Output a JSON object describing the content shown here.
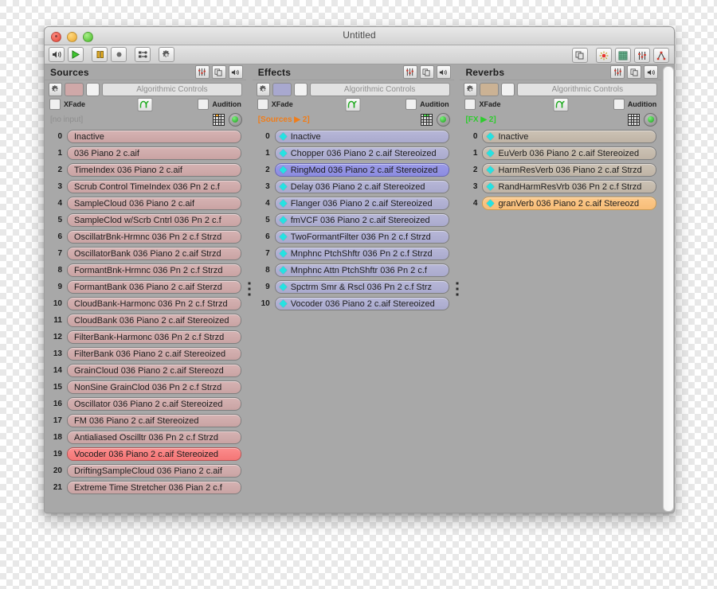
{
  "window": {
    "title": "Untitled",
    "traffic_lights": [
      "close",
      "minimize",
      "zoom"
    ]
  },
  "toolbar": {
    "left_buttons": [
      {
        "name": "speaker-icon",
        "label": "Speaker"
      },
      {
        "name": "play-icon",
        "label": "Play"
      },
      {
        "name": "pause-icon",
        "label": "Pause"
      },
      {
        "name": "record-icon",
        "label": "Record"
      },
      {
        "name": "mixer-icon",
        "label": "Mixer"
      },
      {
        "name": "gear-icon",
        "label": "Settings"
      }
    ],
    "right_buttons": [
      {
        "name": "copy-icon",
        "label": "Copy"
      },
      {
        "name": "sun-icon",
        "label": "Brightness"
      },
      {
        "name": "grid-icon",
        "label": "Grid"
      },
      {
        "name": "faders-icon",
        "label": "Faders"
      },
      {
        "name": "routing-icon",
        "label": "Routing"
      }
    ]
  },
  "panels": [
    {
      "id": "sources",
      "title": "Sources",
      "accent": "#cfa8a8",
      "header_buttons": [
        "faders-icon",
        "copy-icon",
        "speaker-icon"
      ],
      "algorithmic_controls_label": "Algorithmic Controls",
      "xfade_label": "XFade",
      "audition_label": "Audition",
      "input_label": "[no input]",
      "input_label_style": "gray",
      "matrix_led_color": "#f6a21e",
      "items": [
        {
          "index": "0",
          "label": "Inactive",
          "selected": false
        },
        {
          "index": "1",
          "label": " 036 Piano 2 c.aif",
          "selected": false
        },
        {
          "index": "2",
          "label": "TimeIndex 036 Piano 2 c.aif",
          "selected": false
        },
        {
          "index": "3",
          "label": "Scrub Control TimeIndex 036 Pn 2 c.f",
          "selected": false
        },
        {
          "index": "4",
          "label": "SampleCloud 036 Piano 2 c.aif",
          "selected": false
        },
        {
          "index": "5",
          "label": "SampleClod w/Scrb Cntrl 036 Pn 2 c.f",
          "selected": false
        },
        {
          "index": "6",
          "label": "OscillatrBnk-Hrmnc 036 Pn 2 c.f Strzd",
          "selected": false
        },
        {
          "index": "7",
          "label": "OscillatorBank 036 Piano 2 c.aif Strzd",
          "selected": false
        },
        {
          "index": "8",
          "label": "FormantBnk-Hrmnc 036 Pn 2 c.f Strzd",
          "selected": false
        },
        {
          "index": "9",
          "label": "FormantBank 036 Piano 2 c.aif Sterzd",
          "selected": false
        },
        {
          "index": "10",
          "label": "CloudBank-Harmonc 036 Pn 2 c.f Strzd",
          "selected": false
        },
        {
          "index": "11",
          "label": "CloudBank 036 Piano 2 c.aif Stereoized",
          "selected": false
        },
        {
          "index": "12",
          "label": "FilterBank-Harmonc 036 Pn 2 c.f Strzd",
          "selected": false
        },
        {
          "index": "13",
          "label": "FilterBank 036 Piano 2 c.aif Stereoized",
          "selected": false
        },
        {
          "index": "14",
          "label": "GrainCloud 036 Piano 2 c.aif Stereozd",
          "selected": false
        },
        {
          "index": "15",
          "label": "NonSine GrainClod 036 Pn 2 c.f Strzd",
          "selected": false
        },
        {
          "index": "16",
          "label": "Oscillator 036 Piano 2 c.aif Stereoized",
          "selected": false
        },
        {
          "index": "17",
          "label": "FM 036 Piano 2 c.aif Stereoized",
          "selected": false
        },
        {
          "index": "18",
          "label": "Antialiased Oscilltr 036 Pn 2 c.f Strzd",
          "selected": false
        },
        {
          "index": "19",
          "label": "Vocoder 036 Piano 2 c.aif Stereoized",
          "selected": true
        },
        {
          "index": "20",
          "label": "DriftingSampleCloud 036 Piano 2 c.aif",
          "selected": false
        },
        {
          "index": "21",
          "label": "Extreme Time Stretcher 036 Pian 2 c.f",
          "selected": false
        }
      ]
    },
    {
      "id": "effects",
      "title": "Effects",
      "accent": "#a8a8cf",
      "header_buttons": [
        "faders-icon",
        "copy-icon",
        "speaker-icon"
      ],
      "algorithmic_controls_label": "Algorithmic Controls",
      "xfade_label": "XFade",
      "audition_label": "Audition",
      "input_label": "[Sources ▶ 2]",
      "input_label_style": "orange",
      "matrix_led_color": "#4cdd4c",
      "items": [
        {
          "index": "0",
          "label": "Inactive",
          "selected": false,
          "marker": true
        },
        {
          "index": "1",
          "label": "Chopper 036 Piano 2 c.aif Stereoized",
          "selected": false,
          "marker": true
        },
        {
          "index": "2",
          "label": "RingMod 036 Piano 2 c.aif Stereoized",
          "selected": true,
          "marker": true
        },
        {
          "index": "3",
          "label": "Delay 036 Piano 2 c.aif Stereoized",
          "selected": false,
          "marker": true
        },
        {
          "index": "4",
          "label": "Flanger 036 Piano 2 c.aif Stereoized",
          "selected": false,
          "marker": true
        },
        {
          "index": "5",
          "label": "fmVCF 036 Piano 2 c.aif Stereoized",
          "selected": false,
          "marker": true
        },
        {
          "index": "6",
          "label": "TwoFormantFilter 036 Pn 2 c.f Strzd",
          "selected": false,
          "marker": true
        },
        {
          "index": "7",
          "label": "Mnphnc PtchShftr 036 Pn 2 c.f Strzd",
          "selected": false,
          "marker": true
        },
        {
          "index": "8",
          "label": "Mnphnc Attn PtchShftr 036 Pn 2 c.f",
          "selected": false,
          "marker": true
        },
        {
          "index": "9",
          "label": "Spctrm Smr & Rscl 036 Pn 2 c.f Strz",
          "selected": false,
          "marker": true
        },
        {
          "index": "10",
          "label": "Vocoder 036 Piano 2 c.aif Stereoized",
          "selected": false,
          "marker": true
        }
      ]
    },
    {
      "id": "reverbs",
      "title": "Reverbs",
      "accent": "#cbb294",
      "header_buttons": [
        "faders-icon",
        "copy-icon",
        "speaker-icon"
      ],
      "algorithmic_controls_label": "Algorithmic Controls",
      "xfade_label": "XFade",
      "audition_label": "Audition",
      "input_label": "[FX ▶ 2]",
      "input_label_style": "green",
      "matrix_led_color": "#dedede",
      "items": [
        {
          "index": "0",
          "label": "Inactive",
          "selected": false,
          "marker": true
        },
        {
          "index": "1",
          "label": "EuVerb 036 Piano 2 c.aif Stereoized",
          "selected": false,
          "marker": true
        },
        {
          "index": "2",
          "label": "HarmResVerb 036 Piano 2 c.af Strzd",
          "selected": false,
          "marker": true
        },
        {
          "index": "3",
          "label": "RandHarmResVrb 036 Pn 2 c.f Strzd",
          "selected": false,
          "marker": true
        },
        {
          "index": "4",
          "label": "granVerb 036 Piano 2 c.aif Stereozd",
          "selected": true,
          "marker": true
        }
      ]
    }
  ]
}
